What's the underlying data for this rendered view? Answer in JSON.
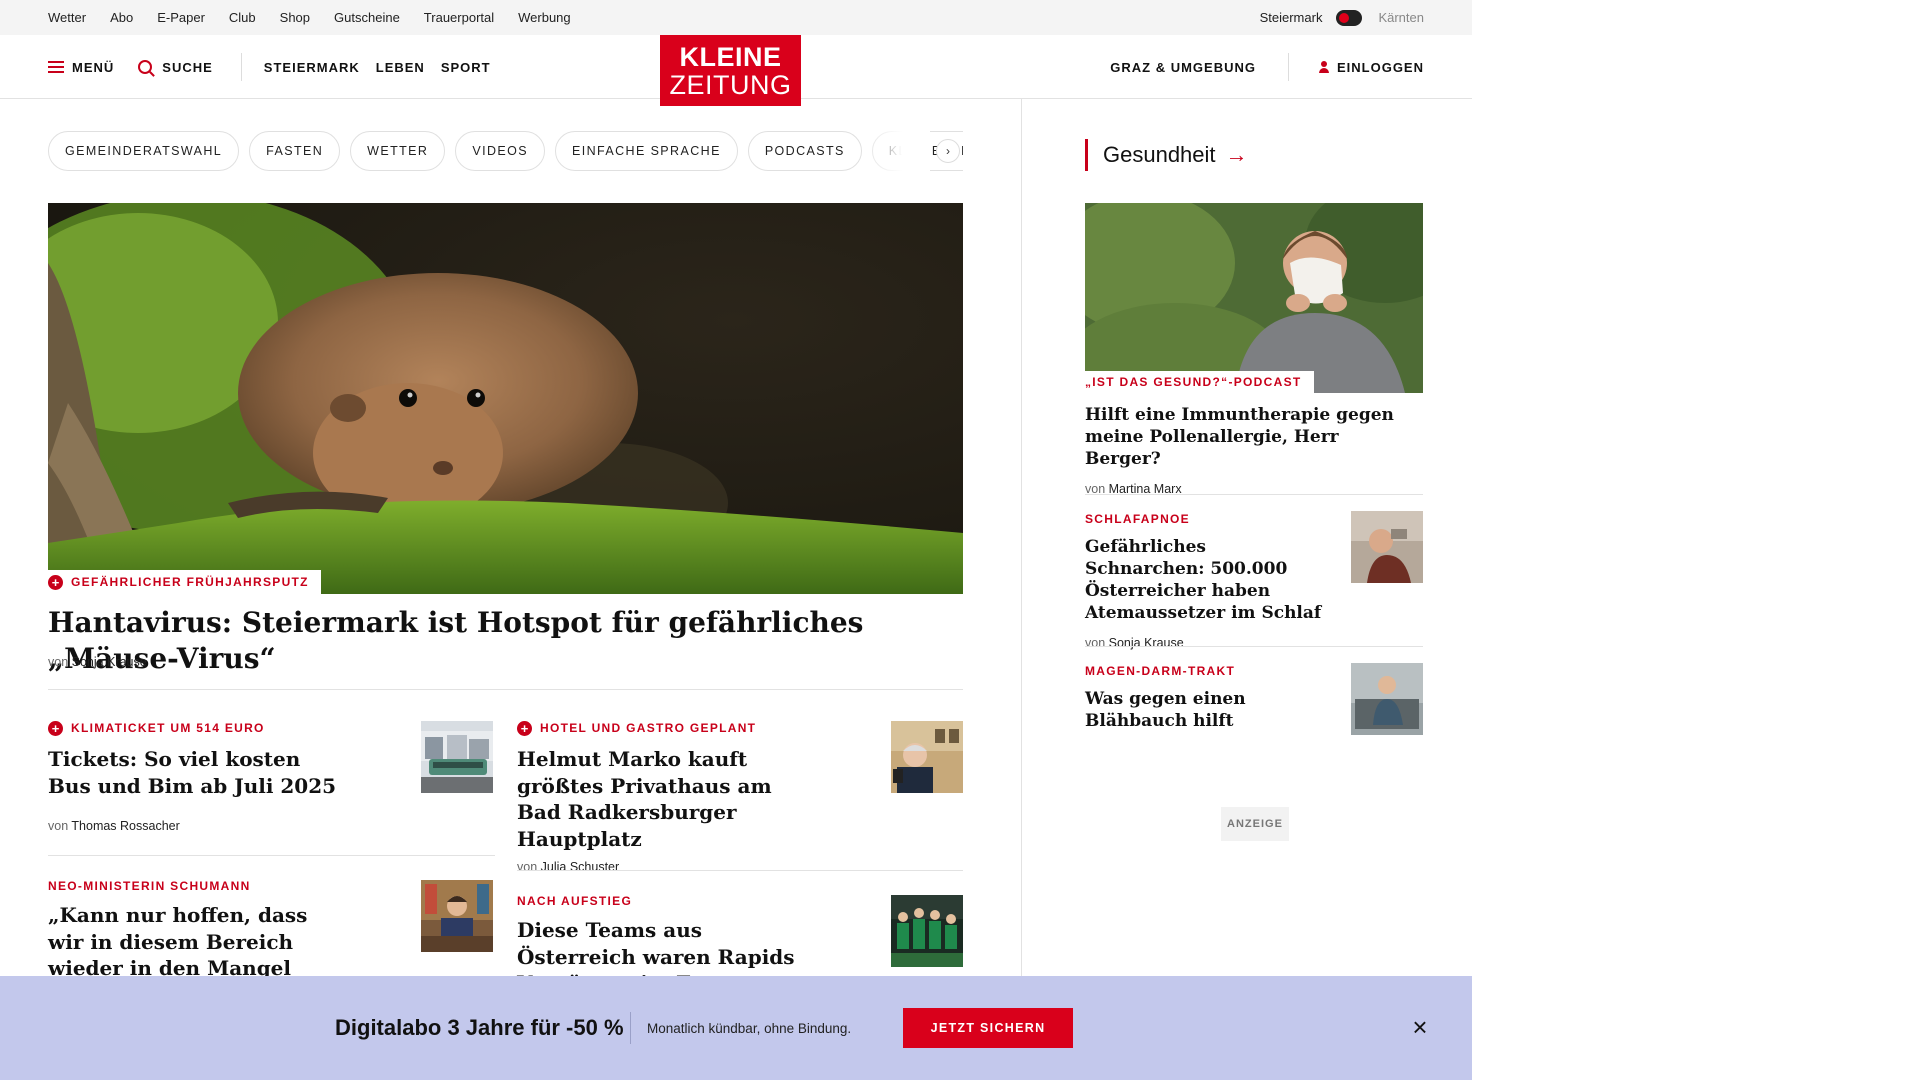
{
  "utility_bar": {
    "links": [
      "Wetter",
      "Abo",
      "E-Paper",
      "Club",
      "Shop",
      "Gutscheine",
      "Trauerportal",
      "Werbung"
    ],
    "region_active": "Steiermark",
    "region_inactive": "Kärnten"
  },
  "header": {
    "menu_label": "MENÜ",
    "search_label": "SUCHE",
    "nav": [
      "STEIERMARK",
      "LEBEN",
      "SPORT"
    ],
    "logo_line1": "KLEINE",
    "logo_line2": "ZEITUNG",
    "region_link": "GRAZ & UMGEBUNG",
    "login_label": "EINLOGGEN"
  },
  "chips": [
    "GEMEINDERATSWAHL",
    "FASTEN",
    "WETTER",
    "VIDEOS",
    "EINFACHE SPRACHE",
    "PODCASTS",
    "KLEINE KINDER"
  ],
  "hero": {
    "kicker": "GEFÄHRLICHER FRÜHJAHRSPUTZ",
    "title": "Hantavirus: Steiermark ist Hotspot für gefährliches „Mäuse-Virus“",
    "by_prefix": "von",
    "author": "Sonja Krause"
  },
  "teasers": [
    {
      "kicker": "KLIMATICKET UM 514 EURO",
      "title": "Tickets: So viel kosten Bus und Bim ab Juli 2025",
      "by_prefix": "von",
      "author": "Thomas Rossacher"
    },
    {
      "kicker": "HOTEL UND GASTRO GEPLANT",
      "title": "Helmut Marko kauft größtes Privathaus am Bad Radkersburger Hauptplatz",
      "by_prefix": "von",
      "author": "Julia Schuster"
    },
    {
      "kicker": "NEO-MINISTERIN SCHUMANN",
      "title": "„Kann nur hoffen, dass wir in diesem Bereich wieder in den Mangel kommen“"
    },
    {
      "kicker": "NACH AUFSTIEG",
      "title": "Diese Teams aus Österreich waren Rapids Vorgänger im Europacup-Viertelfinale"
    }
  ],
  "sidebar": {
    "section_title": "Gesundheit",
    "arrow": "→",
    "items": [
      {
        "kicker": "„IST DAS GESUND?“-PODCAST",
        "title": "Hilft eine Immuntherapie gegen meine Pollenallergie, Herr Berger?",
        "by_prefix": "von",
        "author": "Martina Marx"
      },
      {
        "kicker": "SCHLAFAPNOE",
        "title": "Gefährliches Schnarchen: 500.000 Österreicher haben Atemaussetzer im Schlaf",
        "by_prefix": "von",
        "author": "Sonja Krause"
      },
      {
        "kicker": "MAGEN-DARM-TRAKT",
        "title": "Was gegen einen Blähbauch hilft"
      }
    ],
    "ad_label": "ANZEIGE"
  },
  "promo": {
    "title": "Digitalabo 3 Jahre für -50 %",
    "subtitle": "Monatlich kündbar, ohne Bindung.",
    "button": "JETZT SICHERN",
    "close": "×"
  },
  "colors": {
    "brand_red": "#d9001b",
    "kicker_red": "#c8001a",
    "promo_bg": "#c3c8ec"
  }
}
